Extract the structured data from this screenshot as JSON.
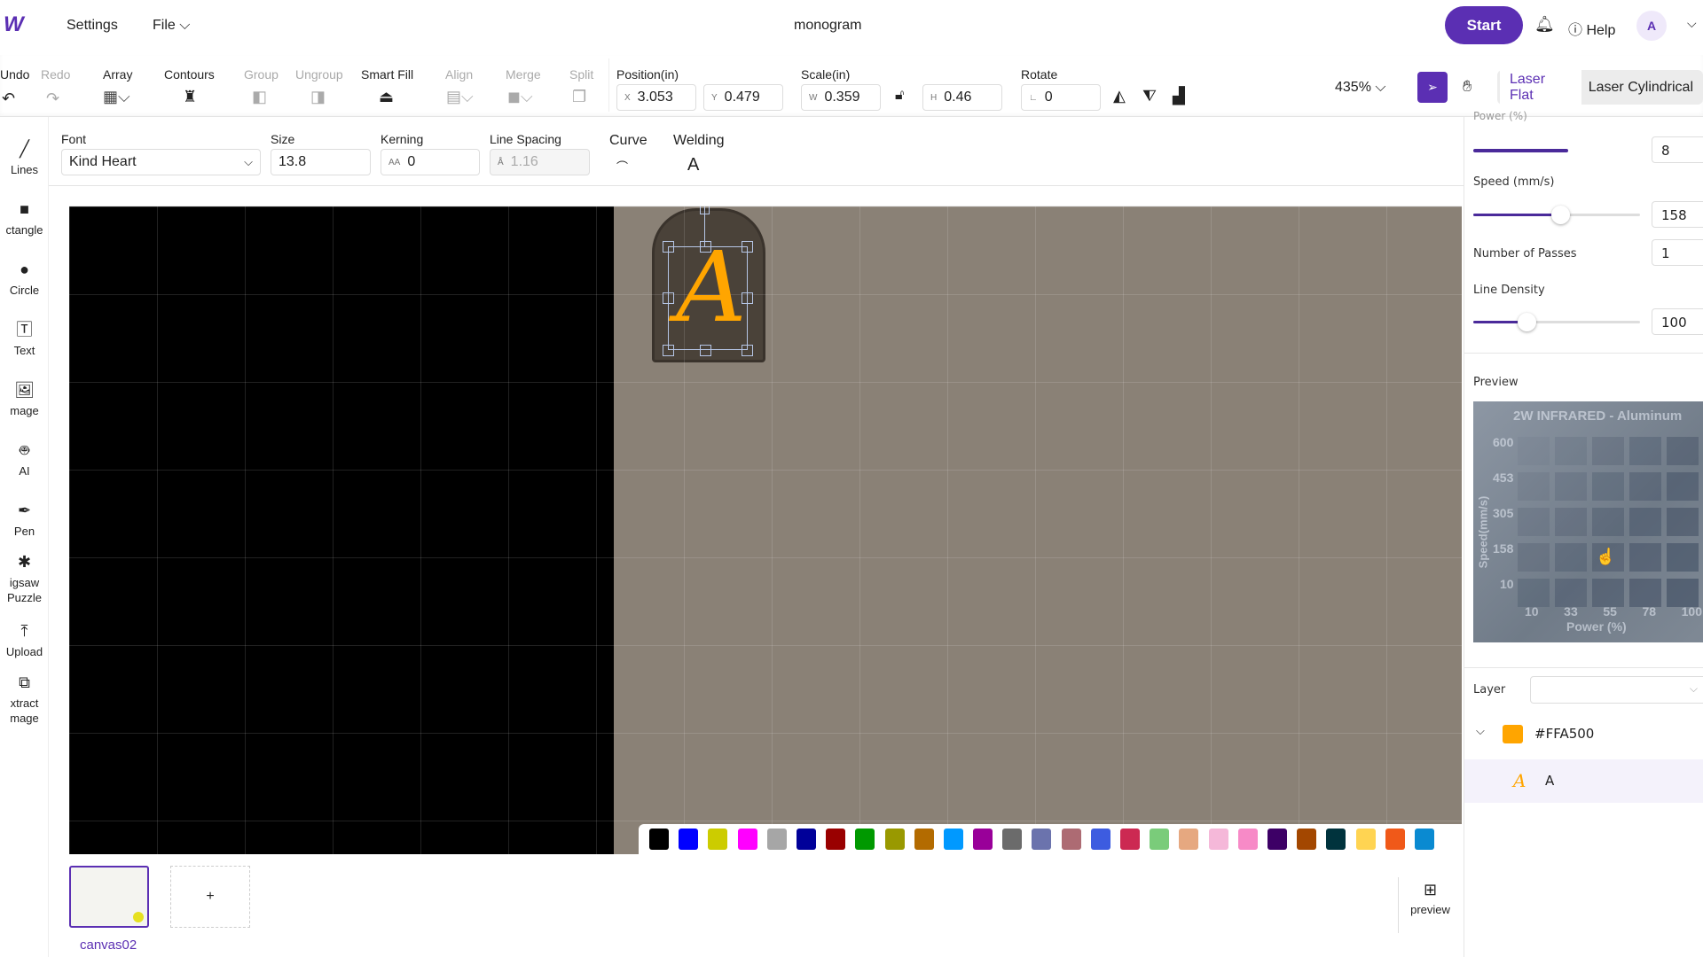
{
  "topbar": {
    "logo": "W",
    "settings": "Settings",
    "file": "File",
    "title": "monogram",
    "start": "Start",
    "help": "Help",
    "avatar": "A"
  },
  "toolbar": {
    "undo": "Undo",
    "redo": "Redo",
    "array": "Array",
    "contours": "Contours",
    "group": "Group",
    "ungroup": "Ungroup",
    "smart_fill": "Smart Fill",
    "align": "Align",
    "merge": "Merge",
    "split": "Split",
    "position_label": "Position(in)",
    "x_prefix": "X",
    "x": "3.053",
    "y_prefix": "Y",
    "y": "0.479",
    "scale_label": "Scale(in)",
    "w_prefix": "W",
    "w": "0.359",
    "h_prefix": "H",
    "h": "0.46",
    "rotate_label": "Rotate",
    "rotate": "0",
    "zoom": "435%",
    "mode_tabs": [
      "Laser Flat",
      "Laser Cylindrical"
    ],
    "active_mode": "Laser Flat"
  },
  "text_tools": {
    "font_label": "Font",
    "font": "Kind Heart",
    "size_label": "Size",
    "size": "13.8",
    "kerning_label": "Kerning",
    "kerning_prefix": "AA",
    "kerning": "0",
    "line_spacing_label": "Line Spacing",
    "line_spacing": "1.16",
    "curve_label": "Curve",
    "welding_label": "Welding"
  },
  "sidebar": {
    "items": [
      "Lines",
      "ctangle",
      "Circle",
      "Text",
      "mage",
      "AI",
      "Pen",
      "igsaw\nPuzzle",
      "Upload",
      "xtract\nmage"
    ]
  },
  "canvas": {
    "selected_text": "A",
    "text_color": "#FFA500"
  },
  "palette": [
    "#000000",
    "#0000ff",
    "#cccc00",
    "#ff00ff",
    "#a6a6a6",
    "#000099",
    "#990000",
    "#009900",
    "#999900",
    "#b36b00",
    "#0099ff",
    "#990099",
    "#6b6b6b",
    "#6b73ad",
    "#ad6b73",
    "#3d5ce0",
    "#cc2952",
    "#7acc7a",
    "#e6a880",
    "#f5b8d9",
    "#f78ac7",
    "#3d0066",
    "#a34700",
    "#00333d",
    "#ffd452",
    "#f05919",
    "#0a8ad1"
  ],
  "bottom": {
    "canvas_name": "canvas02",
    "add": "+",
    "preview": "preview"
  },
  "panel": {
    "power_label": "Power (%)",
    "power": "8",
    "power_fraction": 0.38,
    "speed_label": "Speed (mm/s)",
    "speed": "158",
    "speed_fraction": 0.47,
    "passes_label": "Number of Passes",
    "passes": "1",
    "density_label": "Line Density",
    "density": "100",
    "density_fraction": 0.26,
    "preview_label": "Preview",
    "preview_image": {
      "title": "2W INFRARED - Aluminum",
      "y_label": "Speed(mm/s)",
      "y_ticks": [
        "600",
        "453",
        "305",
        "158",
        "10"
      ],
      "x_label": "Power (%)",
      "x_ticks": [
        "10",
        "33",
        "55",
        "78",
        "100"
      ]
    },
    "layer_label": "Layer",
    "layer_color_name": "#FFA500",
    "layer_color": "#FFA500",
    "layer_item": "A"
  },
  "colors": {
    "accent": "#5b2fb3",
    "orange": "#FFA500"
  }
}
